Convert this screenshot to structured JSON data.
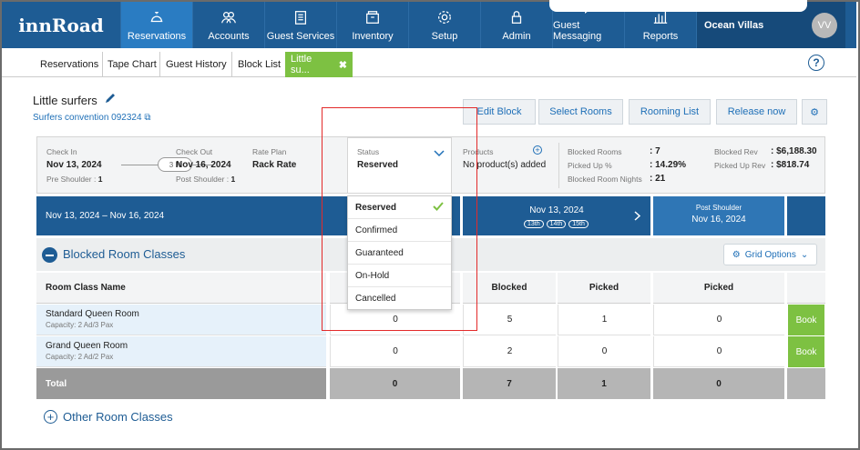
{
  "brand": "innRoad",
  "nav": {
    "items": [
      {
        "label": "Reservations",
        "icon": "bell-icon",
        "active": true
      },
      {
        "label": "Accounts",
        "icon": "people-icon"
      },
      {
        "label": "Guest Services",
        "icon": "clipboard-icon"
      },
      {
        "label": "Inventory",
        "icon": "box-icon"
      },
      {
        "label": "Setup",
        "icon": "gear-icon"
      },
      {
        "label": "Admin",
        "icon": "lock-icon"
      },
      {
        "label": "Guest Messaging",
        "icon": "chat-icon"
      },
      {
        "label": "Reports",
        "icon": "bar-chart-icon"
      }
    ],
    "property": "Ocean Villas",
    "user_initials": "VV"
  },
  "tabs": [
    "Reservations",
    "Tape Chart",
    "Guest History",
    "Block List",
    "Little su..."
  ],
  "help_icon": "?",
  "page": {
    "title": "Little surfers",
    "sublink": "Surfers convention 092324"
  },
  "buttons": [
    "Edit Block",
    "Select Rooms",
    "Rooming List",
    "Release now"
  ],
  "info": {
    "checkin_label": "Check In",
    "checkin": "Nov 13, 2024",
    "pre_label": "Pre Shoulder :",
    "pre": "1",
    "nights": "3 N",
    "checkout_label": "Check Out",
    "checkout": "Nov 16, 2024",
    "post_label": "Post Shoulder :",
    "post": "1",
    "rate_label": "Rate Plan",
    "rate": "Rack Rate",
    "status_label": "Status",
    "status": "Reserved",
    "products_label": "Products",
    "products": "No product(s) added",
    "stats": [
      {
        "label": "Blocked Rooms",
        "value": ": 7"
      },
      {
        "label": "Picked Up %",
        "value": ": 14.29%"
      },
      {
        "label": "Blocked Room Nights",
        "value": ": 21"
      }
    ],
    "rev": [
      {
        "label": "Blocked Rev",
        "value": ": $6,188.30"
      },
      {
        "label": "Picked Up Rev",
        "value": ": $818.74"
      }
    ]
  },
  "dates": {
    "range": "Nov 13, 2024 – Nov 16, 2024",
    "main": "Nov 13, 2024",
    "days": [
      "13th",
      "14th",
      "15th"
    ],
    "post_label": "Post Shoulder",
    "post_date": "Nov 16, 2024"
  },
  "section": {
    "title": "Blocked Room Classes",
    "grid_options": "Grid Options",
    "other": "Other Room Classes"
  },
  "table": {
    "headers": [
      "Room Class Name",
      "Blocked",
      "Picked",
      "Picked"
    ],
    "rows": [
      {
        "name": "Standard Queen Room",
        "cap": "Capacity: 2 Ad/3 Pax",
        "c1": "0",
        "blocked": "5",
        "picked": "1",
        "picked2": "0",
        "book": "Book"
      },
      {
        "name": "Grand Queen Room",
        "cap": "Capacity: 2 Ad/2 Pax",
        "c1": "0",
        "blocked": "2",
        "picked": "0",
        "picked2": "0",
        "book": "Book"
      }
    ],
    "total": {
      "label": "Total",
      "c1": "0",
      "blocked": "7",
      "picked": "1",
      "picked2": "0"
    }
  },
  "dropdown": {
    "options": [
      "Reserved",
      "Confirmed",
      "Guaranteed",
      "On-Hold",
      "Cancelled"
    ],
    "selected": "Reserved"
  }
}
